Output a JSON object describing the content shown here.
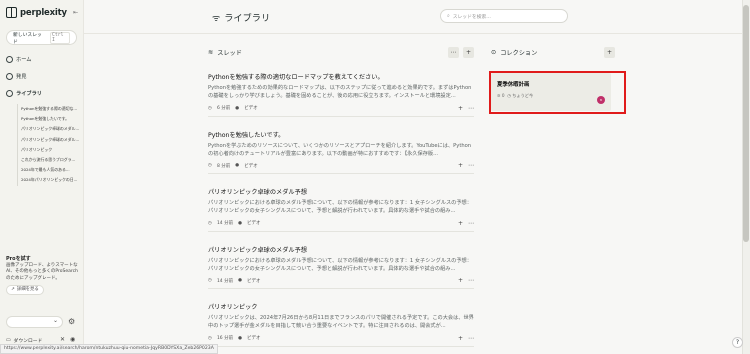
{
  "sidebar": {
    "logo": "perplexity",
    "new_thread": "新しいスレッド",
    "shortcut": "Ctrl I",
    "nav": [
      {
        "label": "ホーム"
      },
      {
        "label": "発見"
      },
      {
        "label": "ライブラリ"
      }
    ],
    "library_items": [
      "Pythonを勉強する際の適切な...",
      "Pythonを勉強したいです。",
      "パリオリンピック卓球のメダル...",
      "パリオリンピック卓球のメダル...",
      "パリオリンピック",
      "これから流行る思うプログラ...",
      "2024年で最も人気のある...",
      "2024年パリオリンピックの日..."
    ],
    "promo_title": "Proを試す",
    "promo_text": "画像アップロード、よりスマートなAI、その他もっと多くのProSearchのためにアップグレード。",
    "promo_button": "詳細を見る",
    "download": "ダウンロード"
  },
  "header": {
    "title": "ライブラリ",
    "search_placeholder": "スレッドを検索..."
  },
  "threads": {
    "section_title": "スレッド",
    "items": [
      {
        "title": "Pythonを勉強する際の適切なロードマップを教えてください。",
        "snippet": "Pythonを勉強するための効果的なロードマップは、以下のステップに従って進めると効果的です。まずはPythonの基礎をしっかり学びましょう。基礎を固めることが、後の応用に役立ちます。インストールと環境設定...",
        "time": "6 分前",
        "tag": "ビデオ"
      },
      {
        "title": "Pythonを勉強したいです。",
        "snippet": "Pythonを学ぶためのリソースについて、いくつかのリソースとアプローチを紹介します。YouTubeには、Pythonの初心者向けのチュートリアルが豊富にあります。以下の動画が特におすすめです：【永久保存版...",
        "time": "8 分前",
        "tag": "ビデオ"
      },
      {
        "title": "パリオリンピック卓球のメダル予想",
        "snippet": "パリオリンピックにおける卓球のメダル予想について、以下の情報が参考になります：1 女子シングルスの予想：パリオリンピックの女子シングルスについて、予想と解説が行われています。具体的な選手や試合の組み...",
        "time": "14 分前",
        "tag": "ビデオ"
      },
      {
        "title": "パリオリンピック卓球のメダル予想",
        "snippet": "パリオリンピックにおける卓球のメダル予想について、以下の情報が参考になります：1 女子シングルスの予想：パリオリンピックの女子シングルスについて、予想と解説が行われています。具体的な選手や試合の組み...",
        "time": "14 分前",
        "tag": "ビデオ"
      },
      {
        "title": "パリオリンピック",
        "snippet": "パリオリンピックは、2024年7月26日から8月11日までフランスのパリで開催される予定です。この大会は、世界中のトップ選手が金メダルを目指して競い合う重要なイベントです。特に注目されるのは、開会式が...",
        "time": "16 分前",
        "tag": "ビデオ"
      }
    ]
  },
  "collections": {
    "section_title": "コレクション",
    "card": {
      "title": "夏季休暇計画",
      "threads": "0",
      "visibility": "ちょうど今",
      "badge": "8"
    }
  },
  "status_url": "https://www.perplexity.ai/search/harom/ntukuzhuu-qiu-nometia-JqyRB0DYSXa_Zeb26P023A"
}
